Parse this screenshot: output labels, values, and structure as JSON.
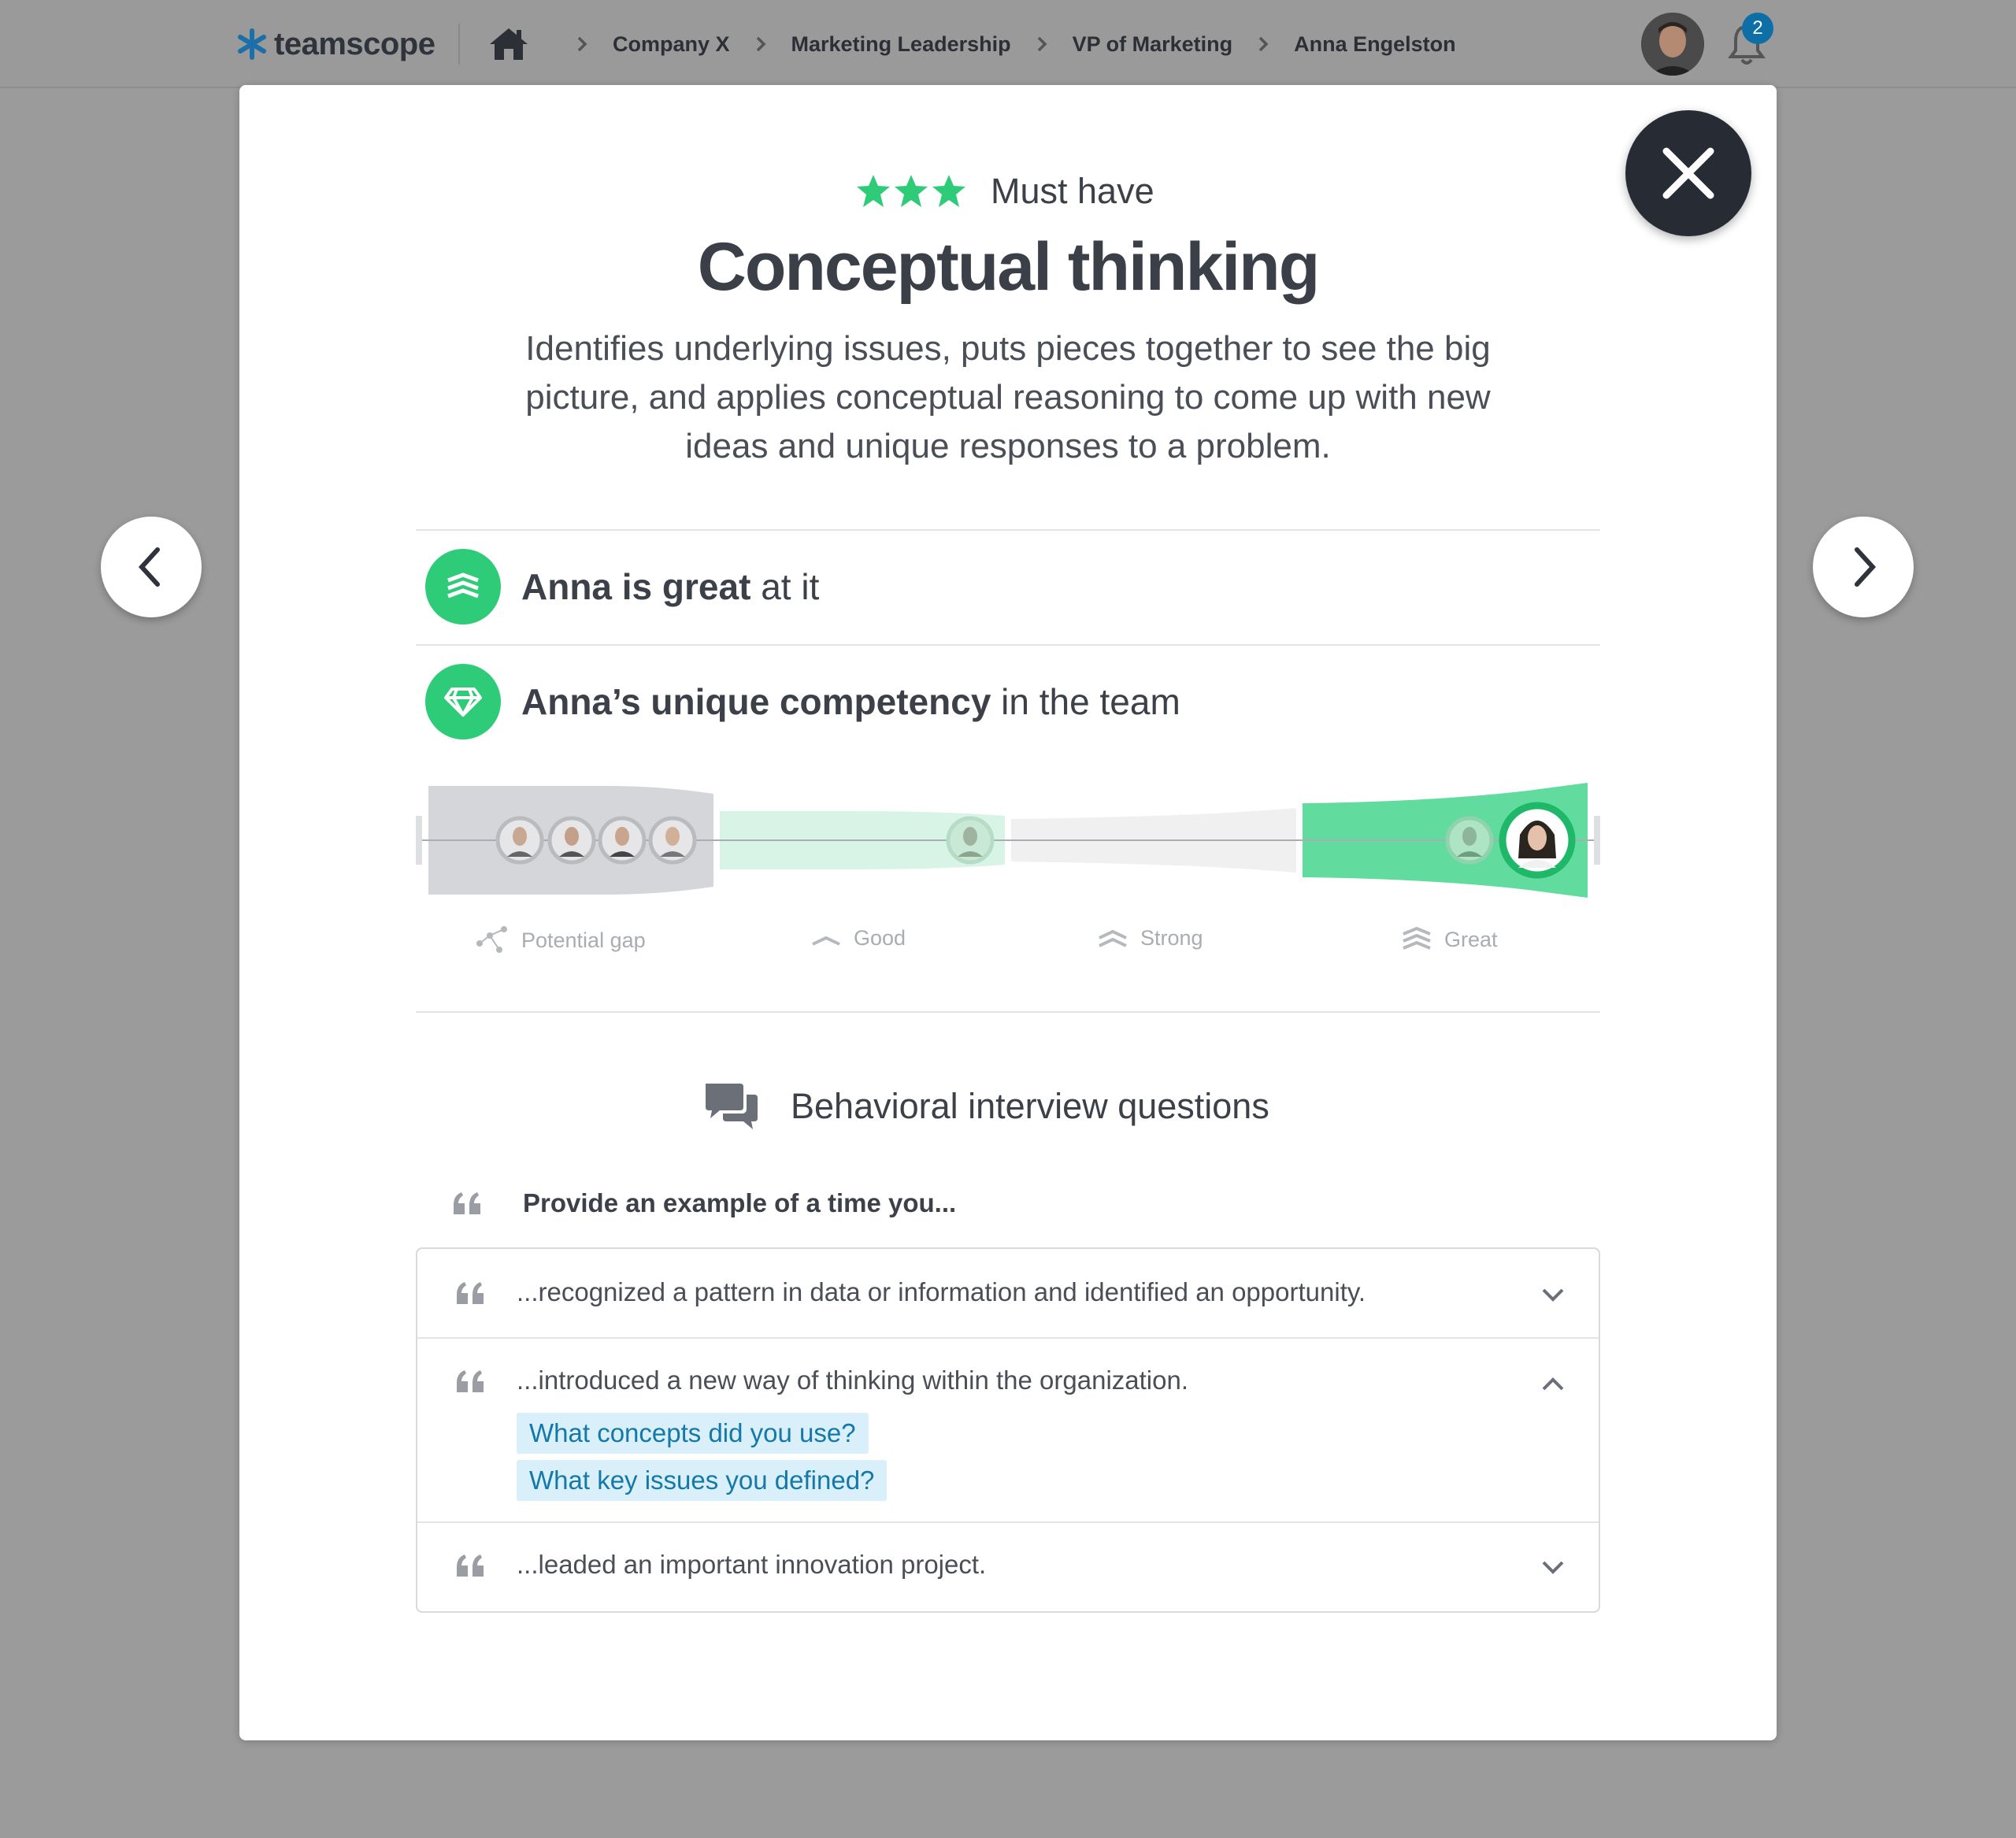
{
  "brand": {
    "name": "teamscope",
    "accent": "#1c6fa8"
  },
  "breadcrumb": [
    "Company X",
    "Marketing Leadership",
    "VP of Marketing",
    "Anna Engelston"
  ],
  "notifications": {
    "count": "2"
  },
  "competency": {
    "importance_label": "Must have",
    "importance_stars": 3,
    "title": "Conceptual thinking",
    "description": "Identifies underlying issues, puts pieces together to see the big picture, and applies conceptual reasoning to come up with new ideas and unique responses to a problem."
  },
  "stats": {
    "rating": {
      "strong": "Anna is great",
      "rest": " at it",
      "icon": "great-level-icon"
    },
    "unique": {
      "strong": "Anna’s unique competency",
      "rest": " in the team",
      "icon": "diamond-icon"
    }
  },
  "distribution": {
    "levels": [
      {
        "label": "Potential gap",
        "icon": "network-icon",
        "people": 4
      },
      {
        "label": "Good",
        "icon": "good-level-icon",
        "people": 1
      },
      {
        "label": "Strong",
        "icon": "strong-level-icon",
        "people": 0
      },
      {
        "label": "Great",
        "icon": "great-level-icon",
        "people": 2
      }
    ],
    "highlighted_person_level": "Great"
  },
  "interview": {
    "heading": "Behavioral interview questions",
    "prompt": "Provide an example of a time you...",
    "questions": [
      {
        "text": "...recognized a pattern in data or information and identified an opportunity.",
        "expanded": false,
        "followups": []
      },
      {
        "text": "...introduced a new way of thinking within the organization.",
        "expanded": true,
        "followups": [
          "What concepts did you use?",
          "What key issues you defined?"
        ]
      },
      {
        "text": "...leaded an important innovation project.",
        "expanded": false,
        "followups": []
      }
    ]
  },
  "colors": {
    "green": "#2ecc79",
    "dark": "#272b33",
    "highlight_bg": "#d9eff9",
    "highlight_text": "#1478a8"
  }
}
